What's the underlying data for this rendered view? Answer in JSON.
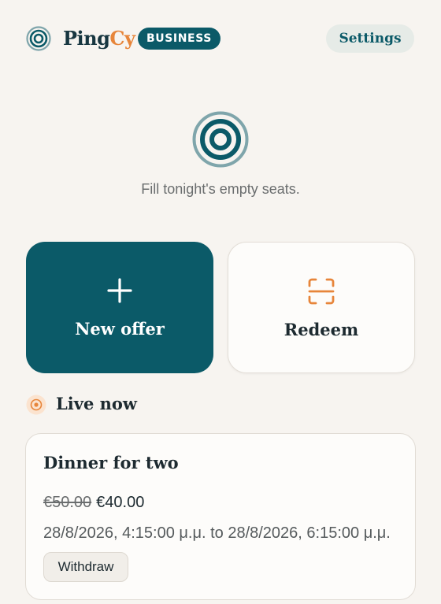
{
  "header": {
    "brand_part1": "Ping",
    "brand_part2": "Cy",
    "badge": "BUSINESS",
    "settings_label": "Settings"
  },
  "hero": {
    "tagline": "Fill tonight's empty seats."
  },
  "actions": {
    "new_offer_label": "New offer",
    "redeem_label": "Redeem"
  },
  "live": {
    "title": "Live now",
    "offers": [
      {
        "title": "Dinner for two",
        "old_price": "€50.00",
        "new_price": "€40.00",
        "time": "28/8/2026, 4:15:00 μ.μ. to 28/8/2026, 6:15:00 μ.μ.",
        "withdraw_label": "Withdraw"
      }
    ]
  },
  "colors": {
    "primary": "#0b5a68",
    "accent": "#e7853a",
    "background": "#f7f4f0"
  },
  "icons": {
    "logo": "target-icon",
    "new_offer": "plus-icon",
    "redeem": "scan-icon",
    "live": "live-dot-icon"
  }
}
